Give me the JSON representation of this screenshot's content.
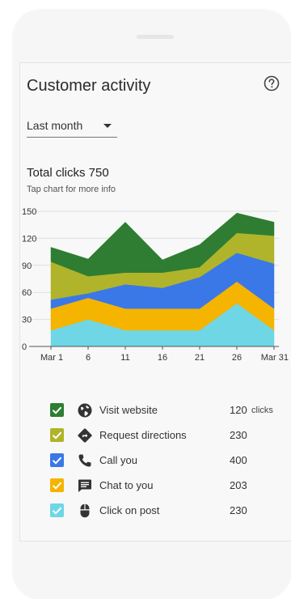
{
  "card": {
    "title": "Customer activity",
    "period": "Last month",
    "total_label": "Total clicks 750",
    "hint": "Tap chart for more info"
  },
  "legend": [
    {
      "label": "Visit website",
      "value": "120",
      "unit": "clicks",
      "color": "#2e7d32",
      "icon": "globe-icon"
    },
    {
      "label": "Request directions",
      "value": "230",
      "unit": "",
      "color": "#afb42b",
      "icon": "directions-icon"
    },
    {
      "label": "Call you",
      "value": "400",
      "unit": "",
      "color": "#3b78e7",
      "icon": "phone-icon"
    },
    {
      "label": "Chat to you",
      "value": "203",
      "unit": "",
      "color": "#f4b400",
      "icon": "chat-icon"
    },
    {
      "label": "Click on post",
      "value": "230",
      "unit": "",
      "color": "#6fd6e6",
      "icon": "mouse-icon"
    }
  ],
  "chart_data": {
    "type": "area",
    "stacked": true,
    "x": [
      "Mar 1",
      "6",
      "11",
      "16",
      "21",
      "26",
      "Mar 31"
    ],
    "ylim": [
      0,
      150
    ],
    "yticks": [
      0,
      30,
      60,
      90,
      120,
      150
    ],
    "grid": true,
    "series": [
      {
        "name": "Click on post",
        "color": "#6fd6e6",
        "values": [
          18,
          30,
          18,
          18,
          18,
          48,
          18
        ]
      },
      {
        "name": "Chat to you",
        "color": "#f4b400",
        "values": [
          24,
          24,
          24,
          24,
          24,
          24,
          24
        ]
      },
      {
        "name": "Call you",
        "color": "#3b78e7",
        "values": [
          10,
          5,
          27,
          23,
          35,
          32,
          50
        ]
      },
      {
        "name": "Request directions",
        "color": "#afb42b",
        "values": [
          42,
          19,
          13,
          17,
          11,
          22,
          31
        ]
      },
      {
        "name": "Visit website",
        "color": "#2e7d32",
        "values": [
          16,
          19,
          56,
          14,
          25,
          22,
          15
        ]
      }
    ]
  }
}
